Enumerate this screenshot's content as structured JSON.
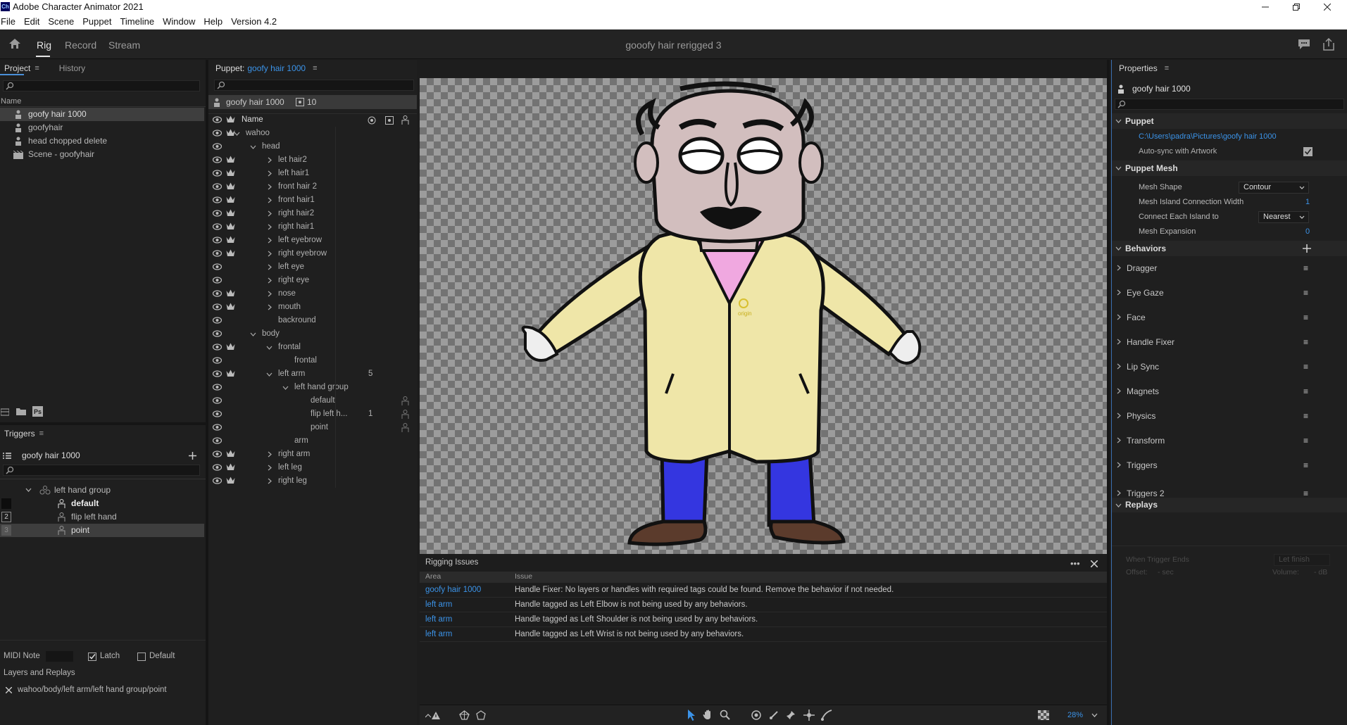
{
  "titlebar": {
    "app_icon": "Ch",
    "title": "Adobe Character Animator 2021"
  },
  "menu": [
    "File",
    "Edit",
    "Scene",
    "Puppet",
    "Timeline",
    "Window",
    "Help",
    "Version 4.2"
  ],
  "modes": {
    "rig": "Rig",
    "record": "Record",
    "stream": "Stream"
  },
  "document_title": "gooofy hair rerigged 3",
  "project": {
    "tabs": {
      "project": "Project",
      "history": "History"
    },
    "column": "Name",
    "items": [
      "goofy hair 1000",
      "goofyhair",
      "head chopped delete",
      "Scene - goofyhair"
    ]
  },
  "triggers": {
    "title": "Triggers",
    "puppet": "goofy hair 1000",
    "group": "left hand group",
    "items": [
      "default",
      "flip left hand",
      "point"
    ],
    "keys": [
      "",
      "2",
      "3"
    ],
    "midi_label": "MIDI Note",
    "latch_label": "Latch",
    "default_label": "Default",
    "layers_title": "Layers and Replays",
    "layer_path": "wahoo/body/left arm/left hand group/point"
  },
  "puppet_panel": {
    "label": "Puppet:",
    "name": "goofy hair 1000",
    "header_name": "goofy hair 1000",
    "count": "10",
    "column": "Name",
    "tree": [
      {
        "label": "wahoo"
      },
      {
        "label": "head"
      },
      {
        "label": "let hair2"
      },
      {
        "label": "left hair1"
      },
      {
        "label": "front hair 2"
      },
      {
        "label": "front hair1"
      },
      {
        "label": "right hair2"
      },
      {
        "label": "right hair1"
      },
      {
        "label": "left eyebrow"
      },
      {
        "label": "right eyebrow"
      },
      {
        "label": "left eye"
      },
      {
        "label": "right eye"
      },
      {
        "label": "nose"
      },
      {
        "label": "mouth"
      },
      {
        "label": "backround"
      },
      {
        "label": "body"
      },
      {
        "label": "frontal"
      },
      {
        "label": "frontal"
      },
      {
        "label": "left arm",
        "num": "5"
      },
      {
        "label": "left hand group"
      },
      {
        "label": "default"
      },
      {
        "label": "flip left h...",
        "num": "1"
      },
      {
        "label": "point"
      },
      {
        "label": "arm"
      },
      {
        "label": "right arm"
      },
      {
        "label": "left leg"
      },
      {
        "label": "right leg"
      }
    ]
  },
  "rigging": {
    "title": "Rigging Issues",
    "col_area": "Area",
    "col_issue": "Issue",
    "rows": [
      {
        "area": "goofy hair 1000",
        "issue": "Handle Fixer: No layers or handles with required tags could be found. Remove the behavior if not needed."
      },
      {
        "area": "left arm",
        "issue": "Handle tagged as Left Elbow is not being used by any behaviors."
      },
      {
        "area": "left arm",
        "issue": "Handle tagged as Left Shoulder is not being used by any behaviors."
      },
      {
        "area": "left arm",
        "issue": "Handle tagged as Left Wrist is not being used by any behaviors."
      }
    ]
  },
  "canvas": {
    "handle_label": "origin"
  },
  "zoom": "28%",
  "properties": {
    "title": "Properties",
    "puppet_name": "goofy hair 1000",
    "sec_puppet": "Puppet",
    "path": "C:\\Users\\padra\\Pictures\\goofy hair 1000",
    "autosync": "Auto-sync with Artwork",
    "sec_mesh": "Puppet Mesh",
    "mesh_shape_label": "Mesh Shape",
    "mesh_shape_value": "Contour",
    "island_width_label": "Mesh Island Connection Width",
    "island_width_value": "1",
    "connect_label": "Connect Each Island to",
    "connect_value": "Nearest",
    "expansion_label": "Mesh Expansion",
    "expansion_value": "0",
    "sec_behaviors": "Behaviors",
    "behaviors": [
      "Dragger",
      "Eye Gaze",
      "Face",
      "Handle Fixer",
      "Lip Sync",
      "Magnets",
      "Physics",
      "Transform",
      "Triggers",
      "Triggers 2"
    ],
    "sec_replays": "Replays",
    "when_ends": "When Trigger Ends",
    "let_finish": "Let finish",
    "offset": "Offset:",
    "offset_val": "- sec",
    "volume": "Volume:",
    "volume_val": "- dB"
  }
}
